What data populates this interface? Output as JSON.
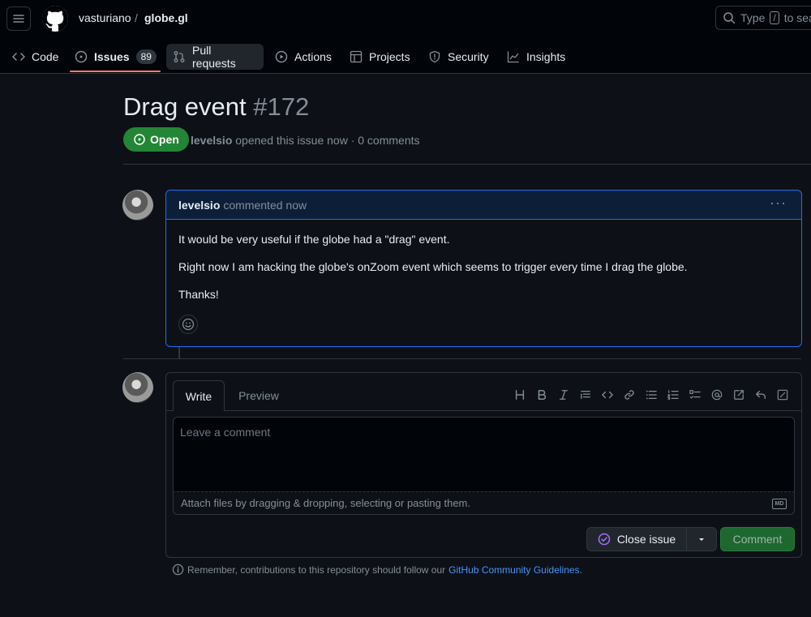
{
  "header": {
    "owner": "vasturiano",
    "separator": "/",
    "repo": "globe.gl",
    "search": {
      "prefix": "Type",
      "key": "/",
      "suffix": "to sear"
    }
  },
  "nav": {
    "tabs": [
      {
        "label": "Code",
        "icon": "code-icon"
      },
      {
        "label": "Issues",
        "icon": "issue-opened-icon",
        "count": "89",
        "active": true
      },
      {
        "label": "Pull requests",
        "icon": "git-pull-request-icon"
      },
      {
        "label": "Actions",
        "icon": "play-icon"
      },
      {
        "label": "Projects",
        "icon": "table-icon"
      },
      {
        "label": "Security",
        "icon": "shield-icon"
      },
      {
        "label": "Insights",
        "icon": "graph-icon"
      }
    ]
  },
  "issue": {
    "title": "Drag event",
    "number": "#172",
    "state": "Open",
    "author": "levelsio",
    "meta_text": "opened this issue now · 0 comments"
  },
  "comment": {
    "author": "levelsio",
    "action": "commented now",
    "paragraphs": [
      "It would be very useful if the globe had a \"drag\" event.",
      "Right now I am hacking the globe's onZoom event which seems to trigger every time I drag the globe.",
      "Thanks!"
    ]
  },
  "editor": {
    "tab_write": "Write",
    "tab_preview": "Preview",
    "placeholder": "Leave a comment",
    "attach_text": "Attach files by dragging & dropping, selecting or pasting them.",
    "md_badge": "MD",
    "close_label": "Close issue",
    "comment_label": "Comment",
    "toolbar_icons": [
      "heading-icon",
      "bold-icon",
      "italic-icon",
      "quote-icon",
      "code-icon",
      "link-icon",
      "unordered-list-icon",
      "ordered-list-icon",
      "tasklist-icon",
      "mention-icon",
      "cross-reference-icon",
      "reply-icon",
      "fullscreen-icon"
    ]
  },
  "footer": {
    "prefix": "Remember, contributions to this repository should follow our",
    "link": "GitHub Community Guidelines",
    "suffix": "."
  },
  "colors": {
    "background": "#0d1117",
    "accent_open": "#238636",
    "link": "#4493f8",
    "active_underline": "#f78166"
  }
}
